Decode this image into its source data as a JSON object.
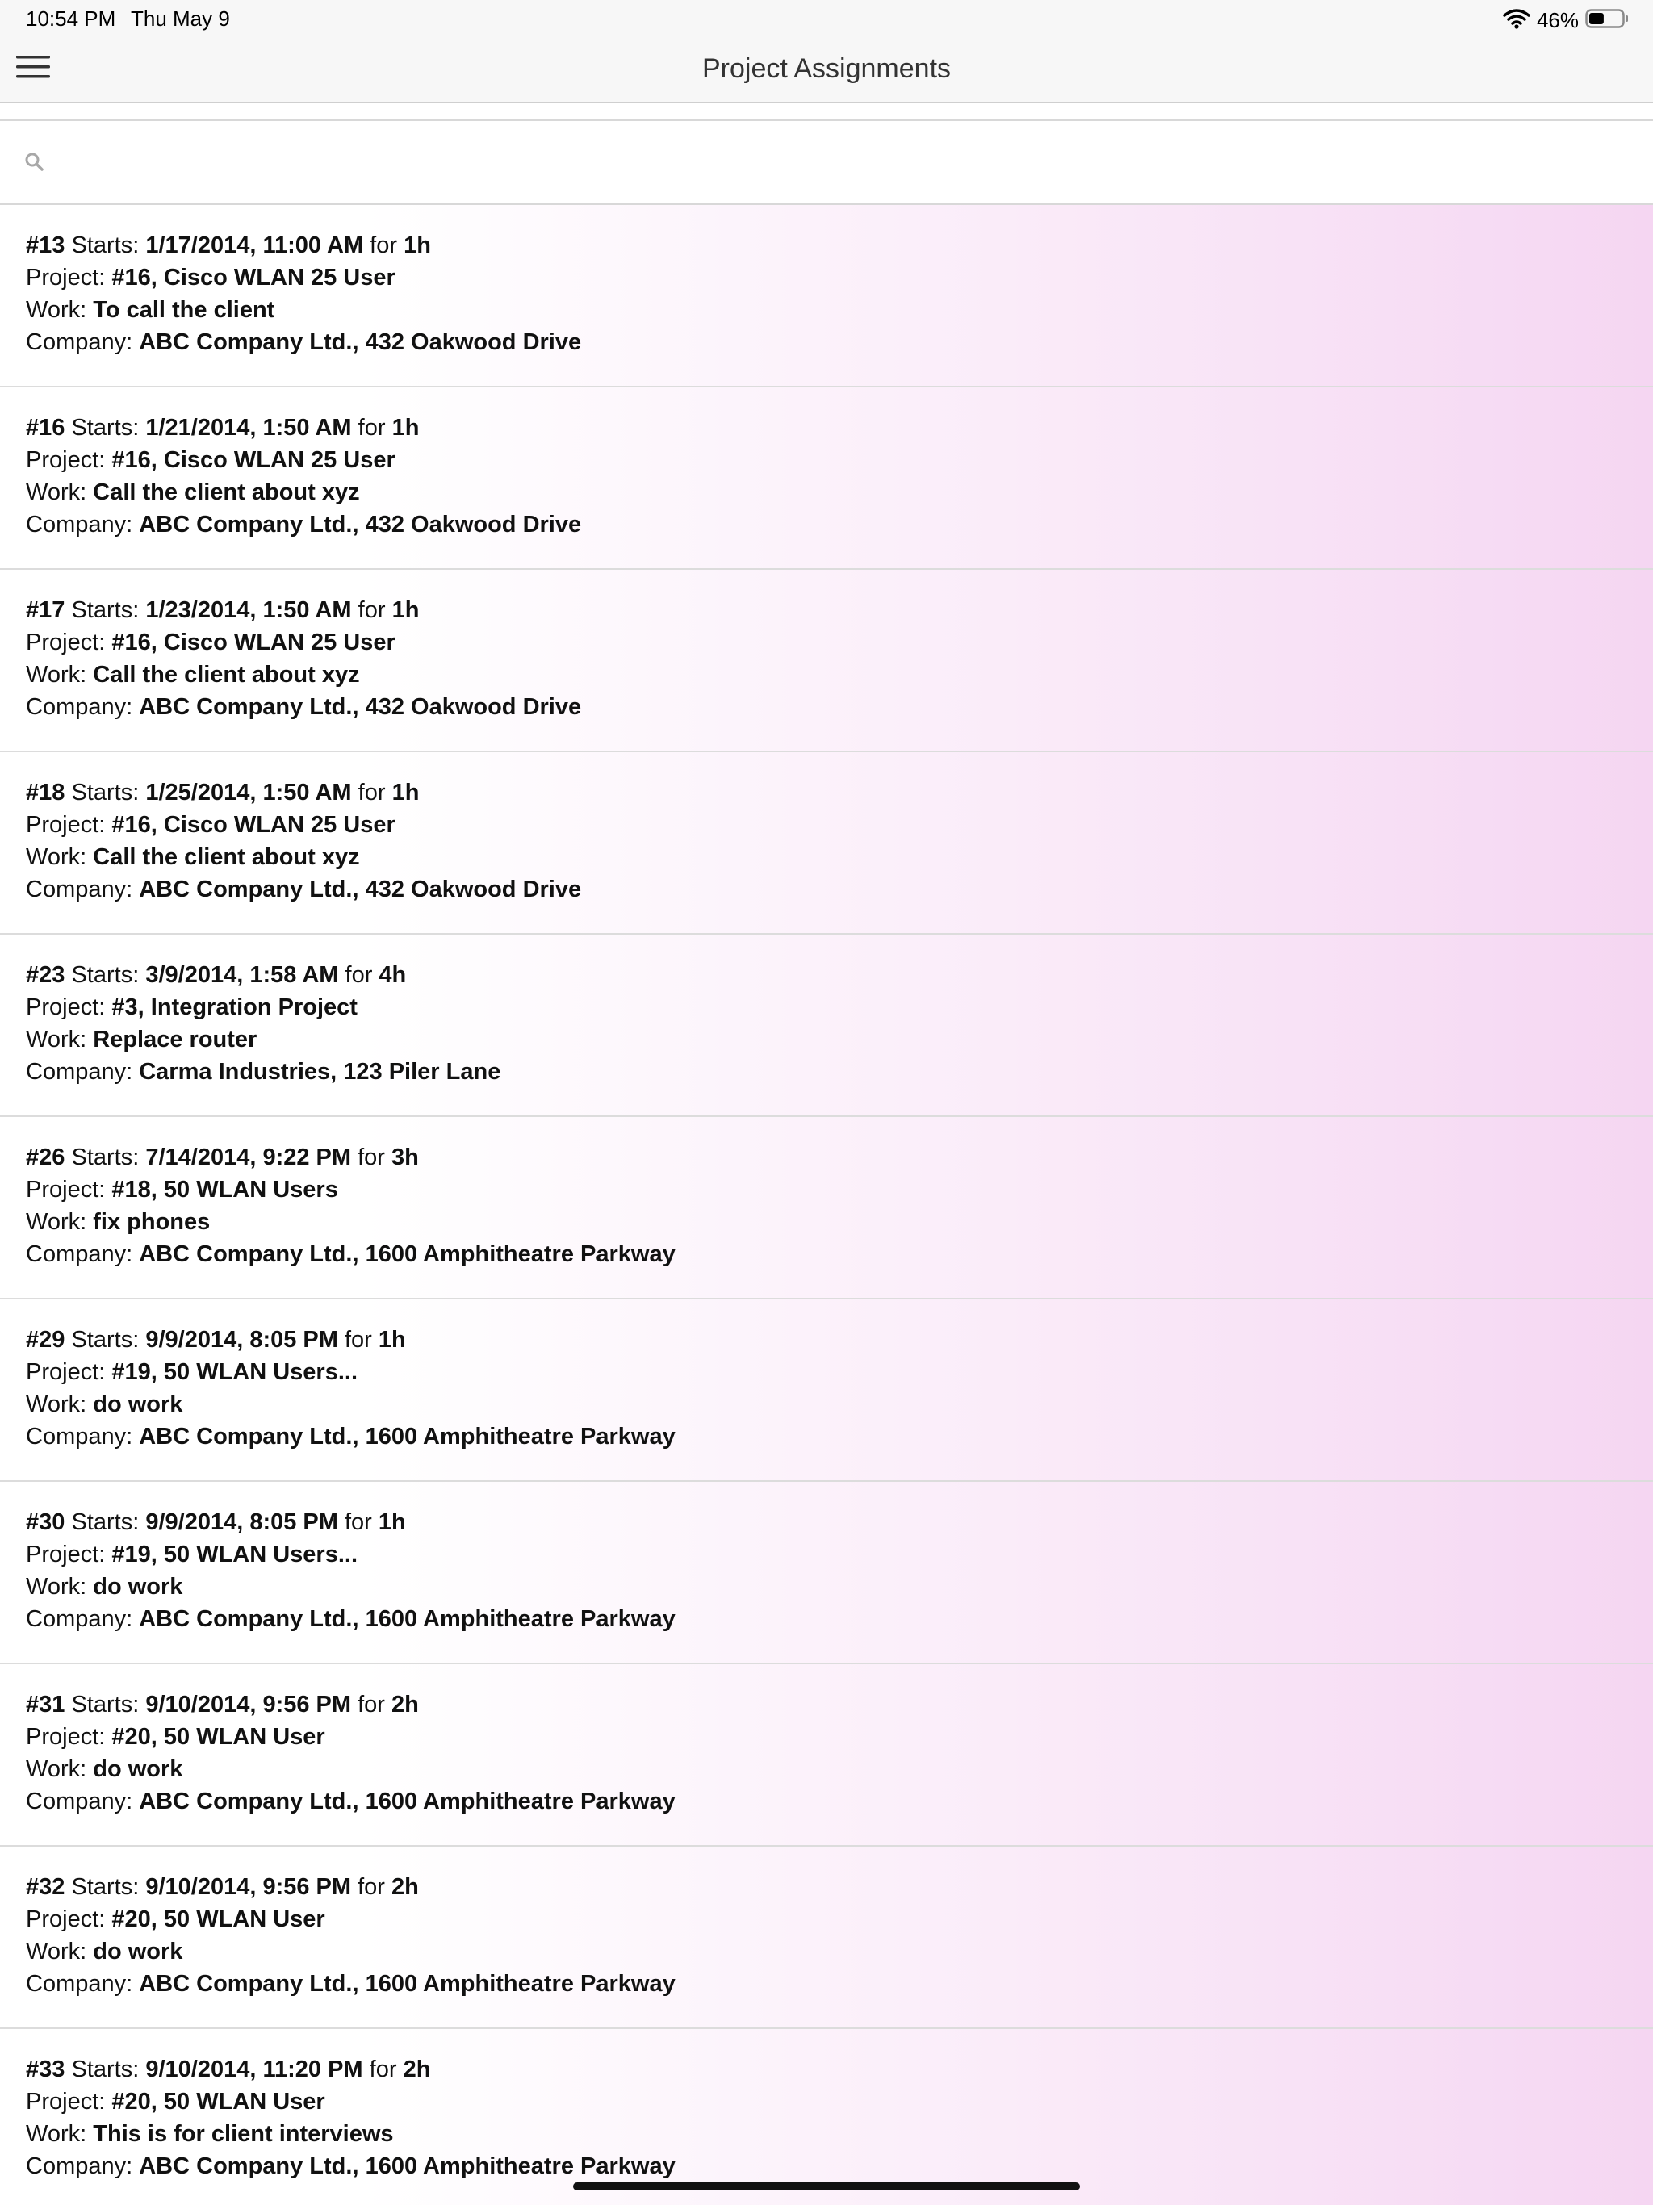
{
  "status": {
    "time": "10:54 PM",
    "date": "Thu May 9",
    "battery_percent": "46%",
    "battery_level": 0.46,
    "wifi_icon": "wifi-icon",
    "battery_icon": "battery-icon"
  },
  "nav": {
    "title": "Project Assignments",
    "menu_icon": "hamburger-menu-icon"
  },
  "search": {
    "icon": "search-icon",
    "placeholder": "",
    "value": ""
  },
  "labels": {
    "starts": "Starts:",
    "for": "for",
    "project": "Project:",
    "work": "Work:",
    "company": "Company:"
  },
  "items": [
    {
      "id": "#13",
      "starts": "1/17/2014, 11:00 AM",
      "duration": "1h",
      "project": "#16, Cisco WLAN 25 User",
      "work": "To call the client",
      "company": "ABC Company Ltd., 432 Oakwood Drive"
    },
    {
      "id": "#16",
      "starts": "1/21/2014, 1:50 AM",
      "duration": "1h",
      "project": "#16, Cisco WLAN 25 User",
      "work": "Call the client about xyz",
      "company": "ABC Company Ltd., 432 Oakwood Drive"
    },
    {
      "id": "#17",
      "starts": "1/23/2014, 1:50 AM",
      "duration": "1h",
      "project": "#16, Cisco WLAN 25 User",
      "work": "Call the client about xyz",
      "company": "ABC Company Ltd., 432 Oakwood Drive"
    },
    {
      "id": "#18",
      "starts": "1/25/2014, 1:50 AM",
      "duration": "1h",
      "project": "#16, Cisco WLAN 25 User",
      "work": "Call the client about xyz",
      "company": "ABC Company Ltd., 432 Oakwood Drive"
    },
    {
      "id": "#23",
      "starts": "3/9/2014, 1:58 AM",
      "duration": "4h",
      "project": "#3, Integration Project",
      "work": "Replace router",
      "company": "Carma Industries, 123 Piler Lane"
    },
    {
      "id": "#26",
      "starts": "7/14/2014, 9:22 PM",
      "duration": "3h",
      "project": "#18, 50 WLAN Users",
      "work": "fix phones",
      "company": "ABC Company Ltd., 1600 Amphitheatre Parkway"
    },
    {
      "id": "#29",
      "starts": "9/9/2014, 8:05 PM",
      "duration": "1h",
      "project": "#19, 50 WLAN Users...",
      "work": "do work",
      "company": "ABC Company Ltd., 1600 Amphitheatre Parkway"
    },
    {
      "id": "#30",
      "starts": "9/9/2014, 8:05 PM",
      "duration": "1h",
      "project": "#19, 50 WLAN Users...",
      "work": "do work",
      "company": "ABC Company Ltd., 1600 Amphitheatre Parkway"
    },
    {
      "id": "#31",
      "starts": "9/10/2014, 9:56 PM",
      "duration": "2h",
      "project": "#20, 50 WLAN User",
      "work": "do work",
      "company": "ABC Company Ltd., 1600 Amphitheatre Parkway"
    },
    {
      "id": "#32",
      "starts": "9/10/2014, 9:56 PM",
      "duration": "2h",
      "project": "#20, 50 WLAN User",
      "work": "do work",
      "company": "ABC Company Ltd., 1600 Amphitheatre Parkway"
    },
    {
      "id": "#33",
      "starts": "9/10/2014, 11:20 PM",
      "duration": "2h",
      "project": "#20, 50 WLAN User",
      "work": "This is for client interviews",
      "company": "ABC Company Ltd., 1600 Amphitheatre Parkway"
    }
  ]
}
